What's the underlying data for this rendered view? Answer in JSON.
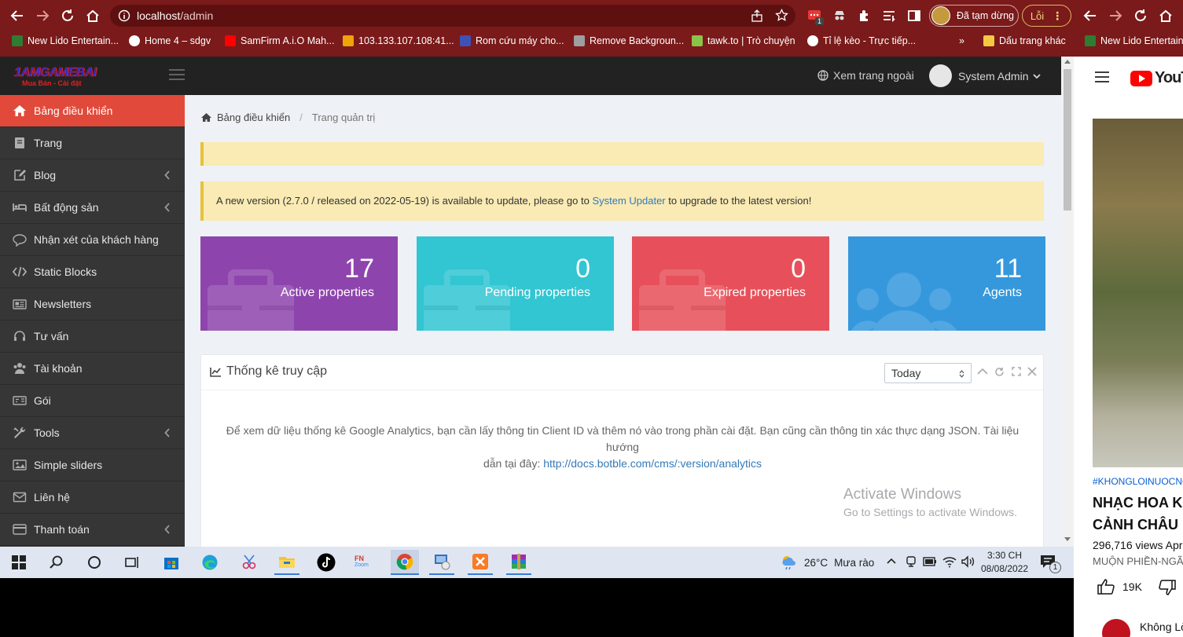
{
  "browser": {
    "url_host": "localhost",
    "url_path": "/admin",
    "profile_status": "Đã tạm dừng",
    "error_label": "Lỗi",
    "ext_badge": "1",
    "bookmarks": [
      {
        "label": "New Lido Entertain...",
        "icon": "lido-icon",
        "color": "#2e7d32"
      },
      {
        "label": "Home 4 – sdgv",
        "icon": "globe-icon",
        "color": "#ffffff"
      },
      {
        "label": "SamFirm A.i.O Mah...",
        "icon": "youtube-icon",
        "color": "#ff0000"
      },
      {
        "label": "103.133.107.108:41...",
        "icon": "facebook-icon",
        "color": "#f0a30a"
      },
      {
        "label": "Rom cứu máy cho...",
        "icon": "rom-icon",
        "color": "#3f51b5"
      },
      {
        "label": "Remove Backgroun...",
        "icon": "removebg-icon",
        "color": "#9e9e9e"
      },
      {
        "label": "tawk.to | Trò chuyện",
        "icon": "tawk-icon",
        "color": "#8bc34a"
      },
      {
        "label": "Tỉ lệ kèo - Trực tiếp...",
        "icon": "soccer-icon",
        "color": "#ffffff"
      }
    ],
    "bookmarks_more": "»",
    "other_bookmarks": "Dấu trang khác"
  },
  "admin": {
    "logo_main": "1AMGAMEBAI",
    "logo_sub": "Mua Bán - Cài đặt",
    "view_site": "Xem trang ngoài",
    "user_name": "System Admin",
    "sidebar": [
      {
        "label": "Bảng điều khiển",
        "icon": "home-icon",
        "active": true,
        "chevron": false
      },
      {
        "label": "Trang",
        "icon": "book-icon",
        "active": false,
        "chevron": false
      },
      {
        "label": "Blog",
        "icon": "edit-icon",
        "active": false,
        "chevron": true
      },
      {
        "label": "Bất động sản",
        "icon": "bed-icon",
        "active": false,
        "chevron": true
      },
      {
        "label": "Nhận xét của khách hàng",
        "icon": "comment-icon",
        "active": false,
        "chevron": false
      },
      {
        "label": "Static Blocks",
        "icon": "code-icon",
        "active": false,
        "chevron": false
      },
      {
        "label": "Newsletters",
        "icon": "newspaper-icon",
        "active": false,
        "chevron": false
      },
      {
        "label": "Tư vấn",
        "icon": "headset-icon",
        "active": false,
        "chevron": false
      },
      {
        "label": "Tài khoản",
        "icon": "users-icon",
        "active": false,
        "chevron": false
      },
      {
        "label": "Gói",
        "icon": "money-icon",
        "active": false,
        "chevron": false
      },
      {
        "label": "Tools",
        "icon": "wrench-icon",
        "active": false,
        "chevron": true
      },
      {
        "label": "Simple sliders",
        "icon": "image-icon",
        "active": false,
        "chevron": false
      },
      {
        "label": "Liên hệ",
        "icon": "envelope-icon",
        "active": false,
        "chevron": false
      },
      {
        "label": "Thanh toán",
        "icon": "card-icon",
        "active": false,
        "chevron": true
      }
    ],
    "breadcrumb": {
      "home": "Bảng điều khiển",
      "sep": "/",
      "current": "Trang quản trị"
    },
    "update_alert": {
      "before": "A new version (2.7.0 / released on 2022-05-19) is available to update, please go to ",
      "link": "System Updater",
      "after": " to upgrade to the latest version!"
    },
    "stats": [
      {
        "value": "17",
        "label": "Active properties",
        "color": "#8e44ad",
        "icon": "briefcase-icon"
      },
      {
        "value": "0",
        "label": "Pending properties",
        "color": "#32c5d2",
        "icon": "briefcase-icon"
      },
      {
        "value": "0",
        "label": "Expired properties",
        "color": "#e7505a",
        "icon": "briefcase-icon"
      },
      {
        "value": "11",
        "label": "Agents",
        "color": "#3598dc",
        "icon": "users-icon"
      }
    ],
    "analytics": {
      "title": "Thống kê truy cập",
      "range_selected": "Today",
      "message": "Để xem dữ liệu thống kê Google Analytics, bạn cần lấy thông tin Client ID và thêm nó vào trong phần cài đặt. Bạn cũng cần thông tin xác thực dạng JSON. Tài liệu hướng",
      "message2": "dẫn tại đây: ",
      "doc_link": "http://docs.botble.com/cms/:version/analytics"
    },
    "watermark": {
      "title": "Activate Windows",
      "sub": "Go to Settings to activate Windows."
    }
  },
  "taskbar": {
    "weather_temp": "26°C",
    "weather_text": "Mưa rào",
    "time": "3:30 CH",
    "date": "08/08/2022",
    "notif_count": "1",
    "zoom_label": "Zoom"
  },
  "youtube": {
    "logo_text": "YouTu",
    "hashtag": "#KHONGLOINUOCNG",
    "title_line1": "NHẠC HOA K",
    "title_line2": "CẢNH CHÂU",
    "views": "296,716 views  Apr",
    "subtitle": "MUỘN PHIỀN-NGÃ",
    "likes": "19K",
    "channel": "Không Lờ"
  }
}
